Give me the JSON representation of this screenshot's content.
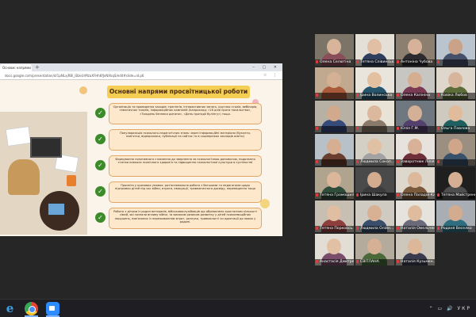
{
  "browser": {
    "tab_title": "Основні напрями",
    "url": "docs.google.com/presentation/d/1pNLxjRBi_iBzeUrMzaXFHh6fJvNXkqS/edit#slide=id.p6",
    "new_tab": "+",
    "window_controls": "– ▢ ✕",
    "nav_icons": "☆ ⋮"
  },
  "slide": {
    "title": "Основні напрями просвітницької роботи",
    "items": [
      {
        "text": "Організація та проведення заходів: тренінгів, інтерактивних занять, круглих столів, вебінарів, тематичних тижнів, інформаційних кампаній (наприклад: «16 днів проти насильства», «Тиждень безпеки дитини», «День протидії булінгу») тощо."
      },
      {
        "text": "Популяризація психолого-педагогічних знань через інформаційні матеріали (буклети, пам'ятки, відеоролики, публікації на сайтах та в соцмережах закладів освіти)"
      },
      {
        "text": "Формування позитивного ставлення до звернення за психологічною допомогою, подолання стигми навколо психічного здоров'я та підвищення психологічної культури в суспільстві"
      },
      {
        "text": "Просвіта у кризових умовах: роз'яснювальна робота з батьками та педагогами щодо підтримки дітей під час війни, втрати, евакуації, травматичного досвіду, переміщення тощо"
      },
      {
        "text": "Робота з дітьми із родин ветеранів, військовослужбовців що обумовлено зростанням кількості сімей, які зазнали впливу війни, та високим ризиком розвитку у дітей психоемоційних порушень, пов'язаних із переживанням втрат, розлуки, тривожності чи адаптації до нових у родині."
      }
    ]
  },
  "participants": [
    {
      "name": "Олена Селютіна",
      "skin": "#d8b49a",
      "cloth": "#8a4d5a",
      "bg": "#7d7468"
    },
    {
      "name": "Тетяна Слівинська",
      "skin": "#e0bfa5",
      "cloth": "#2f3e5c",
      "bg": "#e4e0d8"
    },
    {
      "name": "Антоніна Чубова",
      "skin": "#d7b29a",
      "cloth": "#2b2b30",
      "bg": "#8c7f70"
    },
    {
      "name": "",
      "skin": "#c9a287",
      "cloth": "#46506a",
      "bg": "#b9c4cf"
    },
    {
      "name": "",
      "skin": "#d4b095",
      "cloth": "#a85a3a",
      "bg": "#c0a98e"
    },
    {
      "name": "Ірина Волинська",
      "skin": "#e2c0a0",
      "cloth": "#27556e",
      "bg": "#e9e4dc"
    },
    {
      "name": "Олена Калініна",
      "skin": "#d5ad90",
      "cloth": "#7b3a54",
      "bg": "#c8c6c2"
    },
    {
      "name": "Ковіка Любов",
      "skin": "#d7b59c",
      "cloth": "#5d6d3a",
      "bg": "#dfd6cc"
    },
    {
      "name": "",
      "skin": "#d1a98c",
      "cloth": "#374b7a",
      "bg": "#b7b0a4"
    },
    {
      "name": "",
      "skin": "#dcb89d",
      "cloth": "#8a7a6a",
      "bg": "#e8e2d7"
    },
    {
      "name": "Юлія Г.М.",
      "skin": "#d4b096",
      "cloth": "#54406d",
      "bg": "#6f7780"
    },
    {
      "name": "Ольга Павлова",
      "skin": "#e0bc9d",
      "cloth": "#1f5f5f",
      "bg": "#cfcac0"
    },
    {
      "name": "",
      "skin": "#d6af92",
      "cloth": "#6a3e2e",
      "bg": "#b7c1c7"
    },
    {
      "name": "Людмила Сокол...",
      "skin": "#e1c1a4",
      "cloth": "#a2a2a2",
      "bg": "#d5d0c6"
    },
    {
      "name": "Заворотнюк Лілія",
      "skin": "#d8b298",
      "cloth": "#6e2f3a",
      "bg": "#e7e2db"
    },
    {
      "name": "",
      "skin": "#d0a68a",
      "cloth": "#38516b",
      "bg": "#9a8f80"
    },
    {
      "name": "Тетяна Громошилін",
      "skin": "#dcb69b",
      "cloth": "#2f4d3a",
      "bg": "#b0a48f"
    },
    {
      "name": "Ірина Шакула",
      "skin": "#d3ab8e",
      "cloth": "#3b3b3b",
      "bg": "#4a4a4a"
    },
    {
      "name": "Олена Паладій-Качан",
      "skin": "#ddb99c",
      "cloth": "#7a5a3a",
      "bg": "#ded7cc"
    },
    {
      "name": "Тетяна Майстренко",
      "skin": "#d5af93",
      "cloth": "#4e4e4e",
      "bg": "#1f1f1f"
    },
    {
      "name": "Тетяна Порковсь...",
      "skin": "#e0bea2",
      "cloth": "#8f3e3e",
      "bg": "#c6bfb2"
    },
    {
      "name": "Людмила Олійн...",
      "skin": "#d8b195",
      "cloth": "#384e6a",
      "bg": "#cfcac2"
    },
    {
      "name": "Наталія Омельченко",
      "skin": "#dfbc9e",
      "cloth": "#6a6a7a",
      "bg": "#e6e2dc"
    },
    {
      "name": "Роданя Веселко",
      "skin": "#d3ac90",
      "cloth": "#2e6e7e",
      "bg": "#a8aeb4"
    },
    {
      "name": "Анастасія Дмитренко",
      "skin": "#e1c0a3",
      "cloth": "#7a4e6a",
      "bg": "#e2ddd5"
    },
    {
      "name": "СВІТЛАНА",
      "skin": "#d6b095",
      "cloth": "#4a6a3a",
      "bg": "#b5ab9c"
    },
    {
      "name": "Наталія Кузьмен...",
      "skin": "#ddb79a",
      "cloth": "#3a3a4e",
      "bg": "#cdc6bb"
    }
  ],
  "taskbar": {
    "ie_label": "e",
    "tray_text": "⌃ ▭ 🔊 УКР"
  }
}
